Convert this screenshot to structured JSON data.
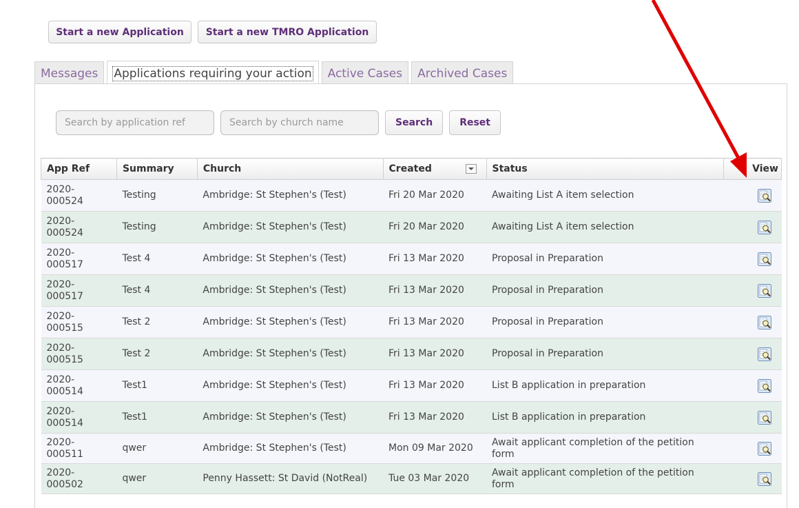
{
  "actions": {
    "new_application": "Start a new Application",
    "new_tmro_application": "Start a new TMRO Application"
  },
  "tabs": [
    {
      "label": "Messages"
    },
    {
      "label": "Applications requiring your action"
    },
    {
      "label": "Active Cases"
    },
    {
      "label": "Archived Cases"
    }
  ],
  "search": {
    "ref_placeholder": "Search by application ref",
    "church_placeholder": "Search by church name",
    "search_label": "Search",
    "reset_label": "Reset"
  },
  "table": {
    "headers": {
      "app_ref": "App Ref",
      "summary": "Summary",
      "church": "Church",
      "created": "Created",
      "status": "Status",
      "view": "View"
    },
    "rows": [
      {
        "ref": "2020-000524",
        "summary": "Testing",
        "church": "Ambridge: St Stephen's (Test)",
        "created": "Fri 20 Mar 2020",
        "status": "Awaiting List A item selection"
      },
      {
        "ref": "2020-000524",
        "summary": "Testing",
        "church": "Ambridge: St Stephen's (Test)",
        "created": "Fri 20 Mar 2020",
        "status": "Awaiting List A item selection"
      },
      {
        "ref": "2020-000517",
        "summary": "Test 4",
        "church": "Ambridge: St Stephen's (Test)",
        "created": "Fri 13 Mar 2020",
        "status": "Proposal in Preparation"
      },
      {
        "ref": "2020-000517",
        "summary": "Test 4",
        "church": "Ambridge: St Stephen's (Test)",
        "created": "Fri 13 Mar 2020",
        "status": "Proposal in Preparation"
      },
      {
        "ref": "2020-000515",
        "summary": "Test 2",
        "church": "Ambridge: St Stephen's (Test)",
        "created": "Fri 13 Mar 2020",
        "status": "Proposal in Preparation"
      },
      {
        "ref": "2020-000515",
        "summary": "Test 2",
        "church": "Ambridge: St Stephen's (Test)",
        "created": "Fri 13 Mar 2020",
        "status": "Proposal in Preparation"
      },
      {
        "ref": "2020-000514",
        "summary": "Test1",
        "church": "Ambridge: St Stephen's (Test)",
        "created": "Fri 13 Mar 2020",
        "status": "List B application in preparation"
      },
      {
        "ref": "2020-000514",
        "summary": "Test1",
        "church": "Ambridge: St Stephen's (Test)",
        "created": "Fri 13 Mar 2020",
        "status": "List B application in preparation"
      },
      {
        "ref": "2020-000511",
        "summary": "qwer",
        "church": "Ambridge: St Stephen's (Test)",
        "created": "Mon 09 Mar 2020",
        "status": "Await applicant completion of the petition form"
      },
      {
        "ref": "2020-000502",
        "summary": "qwer",
        "church": "Penny Hassett: St David (NotReal)",
        "created": "Tue 03 Mar 2020",
        "status": "Await applicant completion of the petition form"
      }
    ]
  },
  "colors": {
    "accent_purple": "#5e2f78",
    "row_odd": "#f5f6fb",
    "row_even": "#e4efe9",
    "annotation_red": "#e00000"
  },
  "icons": {
    "view": "magnifier-document-icon",
    "sort": "dropdown-arrow-icon",
    "annotation": "red-arrow"
  }
}
